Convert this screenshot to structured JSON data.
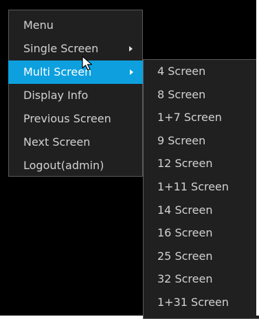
{
  "colors": {
    "background": "#000000",
    "menu_bg": "#202020",
    "menu_border": "#5a5a5a",
    "text": "#d2d2d2",
    "highlight": "#0ea0de",
    "highlight_text": "#ffffff"
  },
  "menu": {
    "title": "Menu",
    "items": [
      {
        "label": "Single Screen",
        "has_submenu": true
      },
      {
        "label": "Multi Screen",
        "has_submenu": true,
        "active": true
      },
      {
        "label": "Display Info",
        "has_submenu": false
      },
      {
        "label": "Previous Screen",
        "has_submenu": false
      },
      {
        "label": "Next Screen",
        "has_submenu": false
      },
      {
        "label": "Logout(admin)",
        "has_submenu": false
      }
    ]
  },
  "submenu": {
    "items": [
      {
        "label": "4 Screen"
      },
      {
        "label": "8 Screen"
      },
      {
        "label": "1+7 Screen"
      },
      {
        "label": "9 Screen"
      },
      {
        "label": "12 Screen"
      },
      {
        "label": "1+11 Screen"
      },
      {
        "label": "14 Screen"
      },
      {
        "label": "16 Screen"
      },
      {
        "label": "25 Screen"
      },
      {
        "label": "32 Screen"
      },
      {
        "label": "1+31 Screen"
      }
    ]
  },
  "cursor_icon": "mouse-pointer-icon",
  "submenu_arrow_icon": "chevron-right-icon"
}
